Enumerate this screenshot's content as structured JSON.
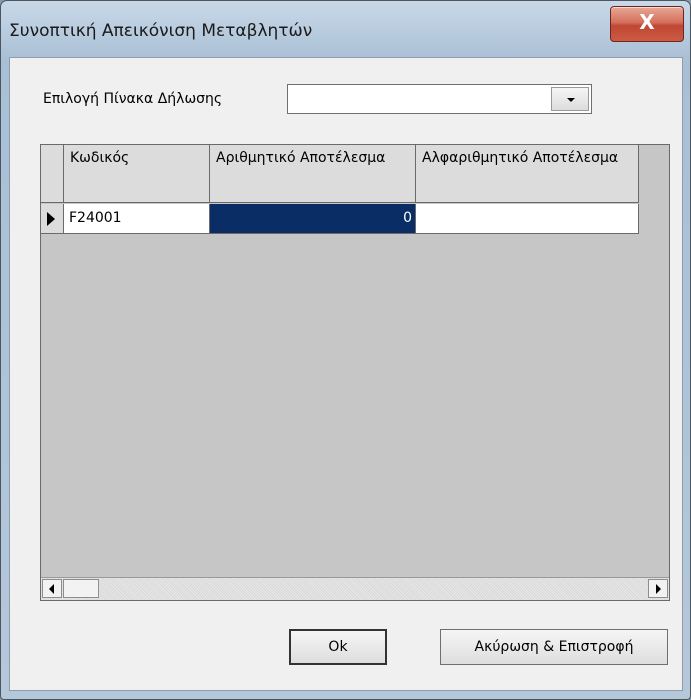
{
  "window": {
    "title": "Συνοπτική Απεικόνιση Μεταβλητών",
    "close_icon": "close-icon",
    "close_label": "X"
  },
  "form": {
    "declaration_label": "Επιλογή Πίνακα Δήλωσης",
    "declaration_value": ""
  },
  "grid": {
    "columns": [
      {
        "label": "Κωδικός"
      },
      {
        "label": "Αριθμητικό Αποτέλεσμα"
      },
      {
        "label": "Αλφαριθμητικό Αποτέλεσμα"
      }
    ],
    "rows": [
      {
        "code": "F24001",
        "numeric": "0",
        "alphanumeric": ""
      }
    ]
  },
  "buttons": {
    "ok_label": "Ok",
    "cancel_label": "Ακύρωση & Επιστροφή"
  }
}
